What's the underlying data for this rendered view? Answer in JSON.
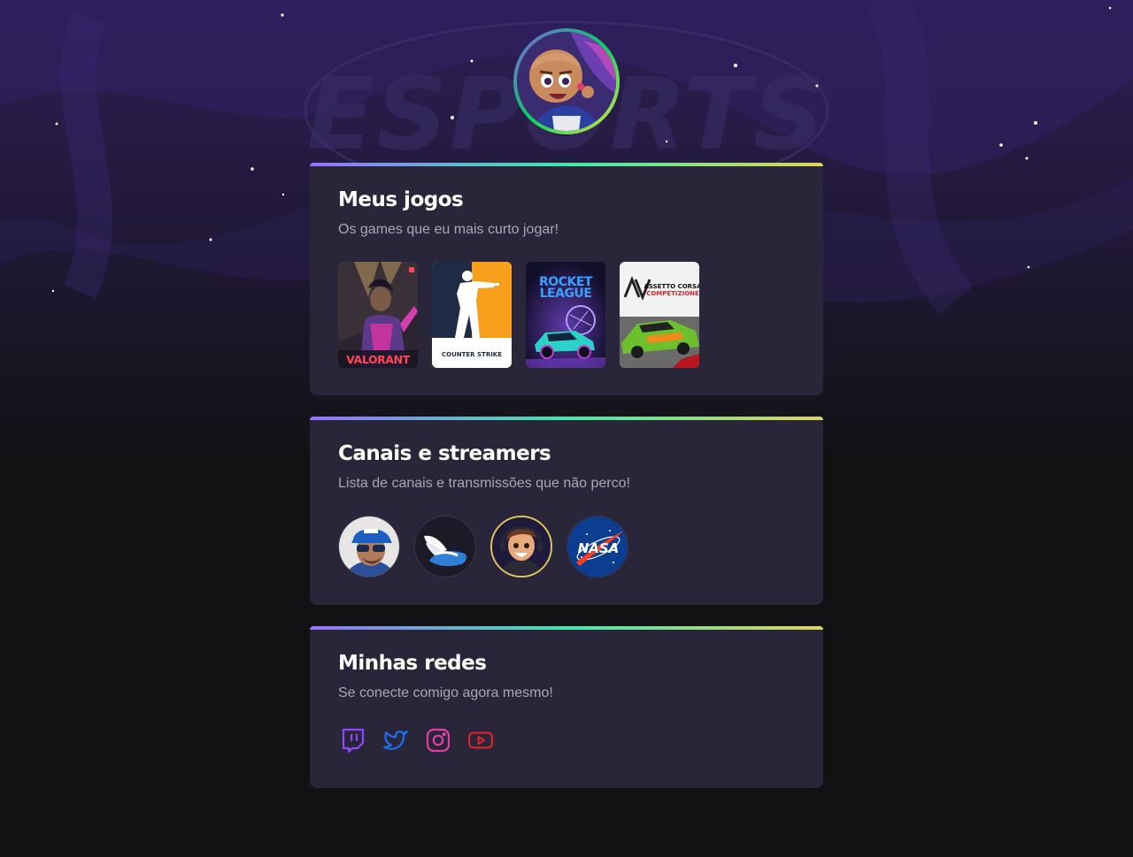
{
  "profile": {
    "avatar_icon": "profile-avatar-illustration"
  },
  "background": {
    "watermark": "ESPORTS"
  },
  "games_card": {
    "title": "Meus jogos",
    "subtitle": "Os games que eu mais curto jogar!",
    "games": [
      {
        "name": "Valorant",
        "label": "VALORANT",
        "color": "#ff4655"
      },
      {
        "name": "Counter-Strike",
        "label": "COUNTER STRIKE",
        "color": "#f8a01c"
      },
      {
        "name": "Rocket League",
        "label_line1": "ROCKET",
        "label_line2": "LEAGUE",
        "color": "#3aa0ff"
      },
      {
        "name": "Assetto Corsa Competizione",
        "label_line1": "ASSETTO CORSA",
        "label_line2": "COMPETIZIONE",
        "color": "#d8242c"
      }
    ]
  },
  "channels_card": {
    "title": "Canais e streamers",
    "subtitle": "Lista de canais e transmissões que não perco!",
    "channels": [
      {
        "name": "streamer-cap-sunglasses",
        "icon": "person-avatar"
      },
      {
        "name": "wing-logo-channel",
        "icon": "wing-icon"
      },
      {
        "name": "cartoon-streamer",
        "icon": "cartoon-avatar"
      },
      {
        "name": "NASA",
        "label": "NASA",
        "icon": "nasa-logo"
      }
    ]
  },
  "socials_card": {
    "title": "Minhas redes",
    "subtitle": "Se conecte comigo agora mesmo!",
    "networks": [
      {
        "name": "Twitch",
        "icon": "twitch-icon",
        "color": "#9147ff"
      },
      {
        "name": "Twitter",
        "icon": "twitter-icon",
        "color": "#1d6ff2"
      },
      {
        "name": "Instagram",
        "icon": "instagram-icon",
        "color": "#e23fa5"
      },
      {
        "name": "YouTube",
        "icon": "youtube-icon",
        "color": "#d8242c"
      }
    ]
  },
  "colors": {
    "page_bg": "#121214",
    "card_bg": "#29263a",
    "gradient_start": "#9572fc",
    "gradient_mid": "#43e7ad",
    "gradient_end": "#e1d55d",
    "text_primary": "#ffffff",
    "text_secondary": "#a8a8b3"
  }
}
